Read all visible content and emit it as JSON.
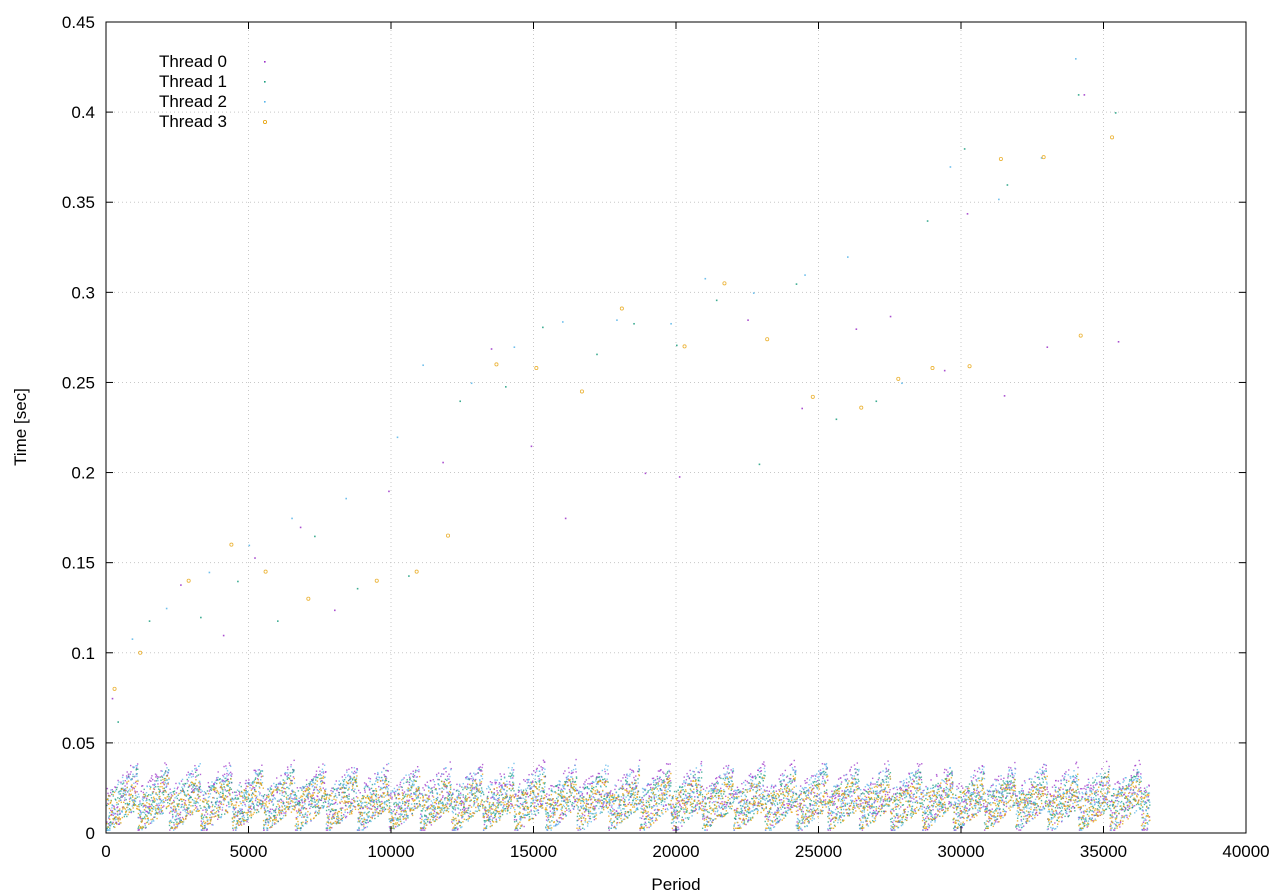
{
  "chart_data": {
    "type": "scatter",
    "title": "",
    "xlabel": "Period",
    "ylabel": "Time [sec]",
    "xlim": [
      0,
      40000
    ],
    "ylim": [
      0,
      0.45
    ],
    "x_ticks": [
      0,
      5000,
      10000,
      15000,
      20000,
      25000,
      30000,
      35000,
      40000
    ],
    "x_tick_labels": [
      "0",
      "5000",
      "10000",
      "15000",
      "20000",
      "25000",
      "30000",
      "35000",
      "40000"
    ],
    "y_ticks": [
      0,
      0.05,
      0.1,
      0.15,
      0.2,
      0.25,
      0.3,
      0.35,
      0.4,
      0.45
    ],
    "y_tick_labels": [
      "0",
      "0.05",
      "0.1",
      "0.15",
      "0.2",
      "0.25",
      "0.3",
      "0.35",
      "0.4",
      "0.45"
    ],
    "grid": true,
    "legend": "top-left",
    "series": [
      {
        "name": "Thread 0",
        "color": "#9b30c8",
        "marker": "dot",
        "band": {
          "x": [
            0,
            36600
          ],
          "y": [
            0.002,
            0.04
          ]
        },
        "points": [
          [
            200,
            0.075
          ],
          [
            2600,
            0.138
          ],
          [
            4100,
            0.11
          ],
          [
            5200,
            0.153
          ],
          [
            6800,
            0.17
          ],
          [
            8000,
            0.124
          ],
          [
            9900,
            0.19
          ],
          [
            11800,
            0.206
          ],
          [
            13500,
            0.269
          ],
          [
            14900,
            0.215
          ],
          [
            16100,
            0.175
          ],
          [
            18900,
            0.2
          ],
          [
            20100,
            0.198
          ],
          [
            22500,
            0.285
          ],
          [
            24400,
            0.236
          ],
          [
            26300,
            0.28
          ],
          [
            27500,
            0.287
          ],
          [
            29400,
            0.257
          ],
          [
            30200,
            0.344
          ],
          [
            31500,
            0.243
          ],
          [
            33000,
            0.27
          ],
          [
            34300,
            0.41
          ],
          [
            35500,
            0.273
          ]
        ]
      },
      {
        "name": "Thread 1",
        "color": "#1a9e7e",
        "marker": "dot",
        "band": {
          "x": [
            0,
            36600
          ],
          "y": [
            0.003,
            0.035
          ]
        },
        "points": [
          [
            400,
            0.062
          ],
          [
            1500,
            0.118
          ],
          [
            3300,
            0.12
          ],
          [
            4600,
            0.14
          ],
          [
            6000,
            0.118
          ],
          [
            7300,
            0.165
          ],
          [
            8800,
            0.136
          ],
          [
            10600,
            0.143
          ],
          [
            12400,
            0.24
          ],
          [
            14000,
            0.248
          ],
          [
            15300,
            0.281
          ],
          [
            17200,
            0.266
          ],
          [
            18500,
            0.283
          ],
          [
            20000,
            0.271
          ],
          [
            21400,
            0.296
          ],
          [
            22900,
            0.205
          ],
          [
            24200,
            0.305
          ],
          [
            25600,
            0.23
          ],
          [
            27000,
            0.24
          ],
          [
            28800,
            0.34
          ],
          [
            30100,
            0.38
          ],
          [
            31600,
            0.36
          ],
          [
            34100,
            0.41
          ],
          [
            35400,
            0.4
          ]
        ]
      },
      {
        "name": "Thread 2",
        "color": "#56b4e9",
        "marker": "dot",
        "band": {
          "x": [
            0,
            36600
          ],
          "y": [
            0.002,
            0.038
          ]
        },
        "points": [
          [
            900,
            0.108
          ],
          [
            2100,
            0.125
          ],
          [
            3600,
            0.145
          ],
          [
            5000,
            0.16
          ],
          [
            6500,
            0.175
          ],
          [
            8400,
            0.186
          ],
          [
            10200,
            0.22
          ],
          [
            11100,
            0.26
          ],
          [
            12800,
            0.25
          ],
          [
            14300,
            0.27
          ],
          [
            16000,
            0.284
          ],
          [
            17900,
            0.285
          ],
          [
            19800,
            0.283
          ],
          [
            21000,
            0.308
          ],
          [
            22700,
            0.3
          ],
          [
            24500,
            0.31
          ],
          [
            26000,
            0.32
          ],
          [
            27900,
            0.25
          ],
          [
            29600,
            0.37
          ],
          [
            31300,
            0.352
          ],
          [
            32800,
            0.375
          ],
          [
            34000,
            0.43
          ]
        ]
      },
      {
        "name": "Thread 3",
        "color": "#e69f00",
        "marker": "circle",
        "band": {
          "x": [
            0,
            36600
          ],
          "y": [
            0.003,
            0.032
          ]
        },
        "points": [
          [
            300,
            0.08
          ],
          [
            1200,
            0.1
          ],
          [
            2900,
            0.14
          ],
          [
            4400,
            0.16
          ],
          [
            5600,
            0.145
          ],
          [
            7100,
            0.13
          ],
          [
            9500,
            0.14
          ],
          [
            10900,
            0.145
          ],
          [
            12000,
            0.165
          ],
          [
            13700,
            0.26
          ],
          [
            15100,
            0.258
          ],
          [
            16700,
            0.245
          ],
          [
            18100,
            0.291
          ],
          [
            20300,
            0.27
          ],
          [
            21700,
            0.305
          ],
          [
            23200,
            0.274
          ],
          [
            24800,
            0.242
          ],
          [
            26500,
            0.236
          ],
          [
            27800,
            0.252
          ],
          [
            29000,
            0.258
          ],
          [
            30300,
            0.259
          ],
          [
            31400,
            0.374
          ],
          [
            32900,
            0.375
          ],
          [
            34200,
            0.276
          ],
          [
            35300,
            0.386
          ]
        ]
      }
    ]
  }
}
